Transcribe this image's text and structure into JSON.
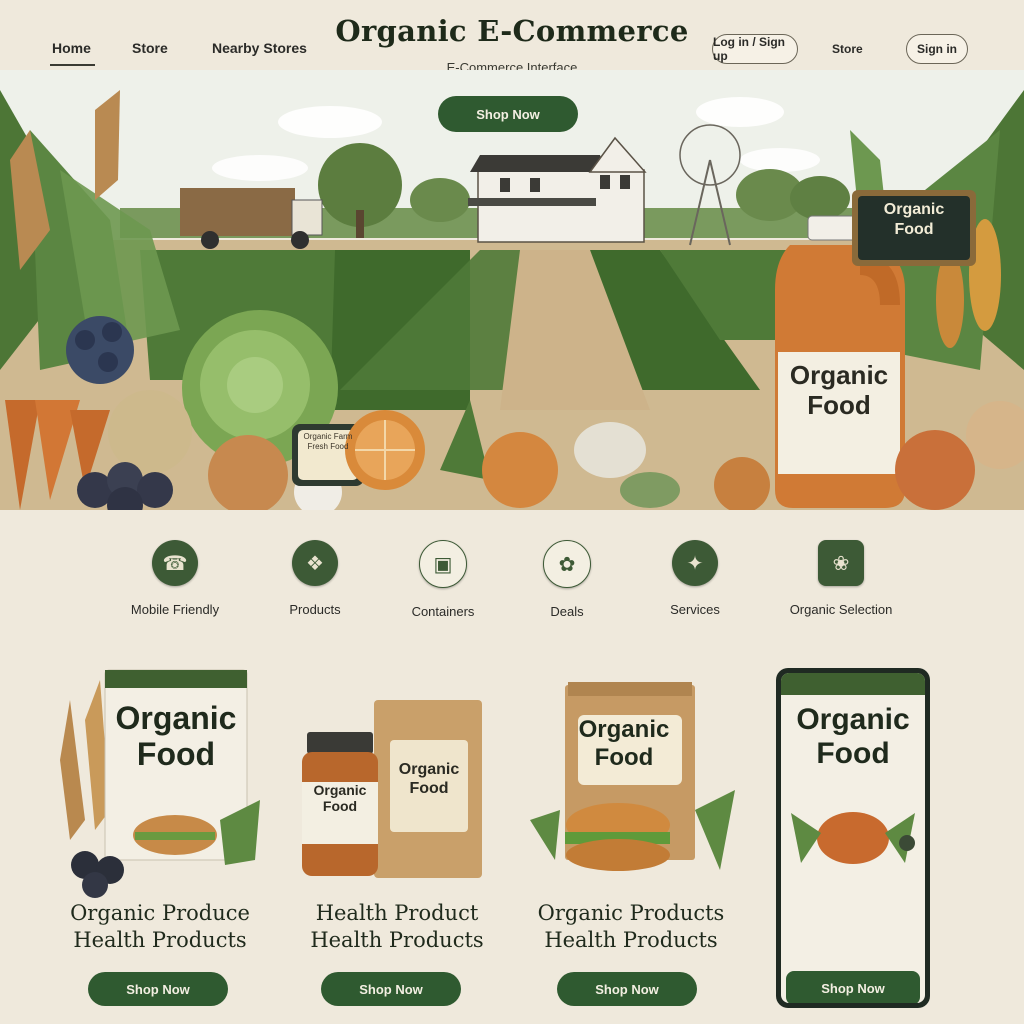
{
  "header": {
    "site_title": "Organic E-Commerce",
    "tagline": "E-Commerce Interface",
    "nav": [
      {
        "label": "Home",
        "active": true
      },
      {
        "label": "Store",
        "active": false
      },
      {
        "label": "Nearby Stores",
        "active": false
      }
    ],
    "right_nav": {
      "account_pill": "Log in / Sign up",
      "store_link": "Store",
      "signin_pill": "Sign in"
    }
  },
  "hero": {
    "cta_label": "Shop Now",
    "sign_text": "Organic Food",
    "jug_label": "Organic Food",
    "small_sign_text": "Organic Farm Fresh Food"
  },
  "features": [
    {
      "label": "Mobile Friendly",
      "icon": "phone-icon"
    },
    {
      "label": "Products",
      "icon": "basket-icon"
    },
    {
      "label": "Containers",
      "icon": "jar-icon"
    },
    {
      "label": "Deals",
      "icon": "tag-icon"
    },
    {
      "label": "Services",
      "icon": "truck-icon"
    },
    {
      "label": "Organic Selection",
      "icon": "leaf-icon"
    }
  ],
  "products": [
    {
      "pack_text": "Organic Food",
      "title_line1": "Organic Produce",
      "title_line2": "Health Products",
      "button": "Shop Now"
    },
    {
      "jar_text": "Organic Food",
      "pack_text": "Organic Food",
      "title_line1": "Health Product",
      "title_line2": "Health Products",
      "button": "Shop Now"
    },
    {
      "pack_text": "Organic Food",
      "title_line1": "Organic Products",
      "title_line2": "Health Products",
      "button": "Shop Now"
    },
    {
      "pack_text": "Organic Food",
      "button": "Shop Now"
    }
  ],
  "colors": {
    "background": "#efe9dc",
    "brand_green": "#2f5a30",
    "icon_green": "#3d5a36",
    "cream": "#f3efe2"
  }
}
